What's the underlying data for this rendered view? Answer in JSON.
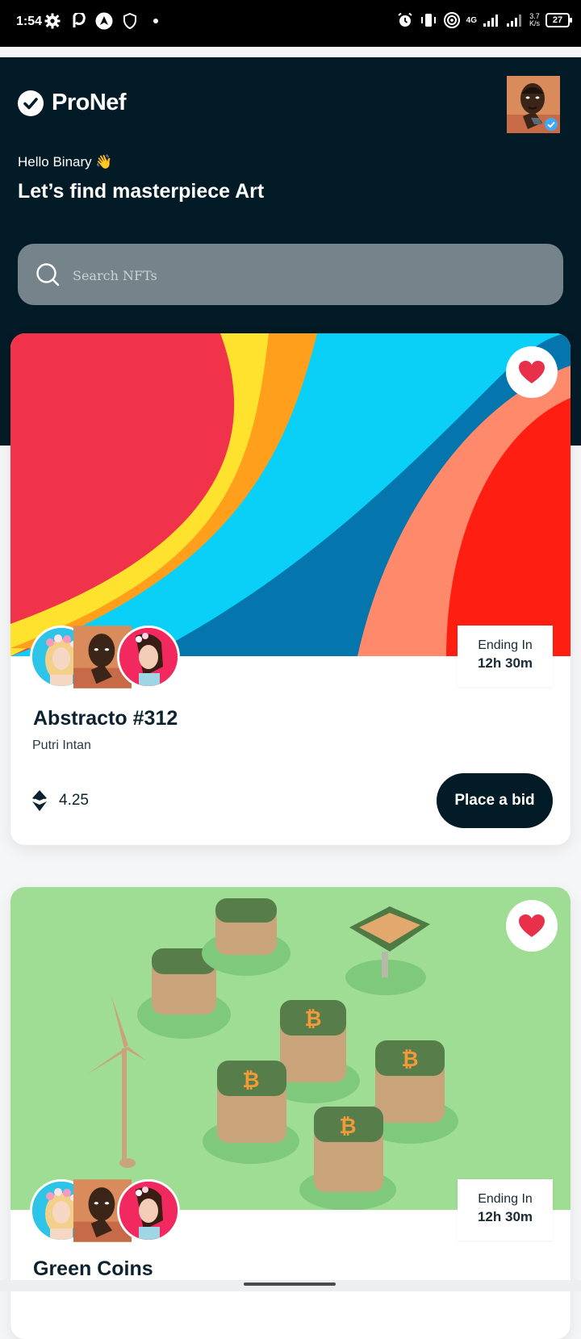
{
  "status_bar": {
    "time": "1:54",
    "network": "4G",
    "speed_value": "3.7",
    "speed_unit": "K/s",
    "battery": "27",
    "icons": [
      "settings-icon",
      "p-app-icon",
      "navigation-icon",
      "shield-icon",
      "dot-icon",
      "alarm-icon",
      "vibrate-icon",
      "hotspot-icon",
      "signal-icon",
      "signal-icon"
    ]
  },
  "app": {
    "name": "ProNef",
    "greeting": "Hello Binary 👋",
    "headline": "Let’s find masterpiece Art"
  },
  "search": {
    "placeholder": "Search NFTs",
    "value": ""
  },
  "cards": [
    {
      "title": "Abstracto #312",
      "author": "Putri Intan",
      "price": "4.25",
      "ending_label": "Ending In",
      "ending_value": "12h 30m",
      "bid_label": "Place a bid",
      "favorited": true
    },
    {
      "title": "Green Coins",
      "ending_label": "Ending In",
      "ending_value": "12h 30m",
      "favorited": true
    }
  ],
  "colors": {
    "header_bg": "#021b26",
    "search_bg": "#75848a",
    "heart": "#e8304a",
    "button_bg": "#021b26",
    "verified": "#3fa9f5"
  }
}
